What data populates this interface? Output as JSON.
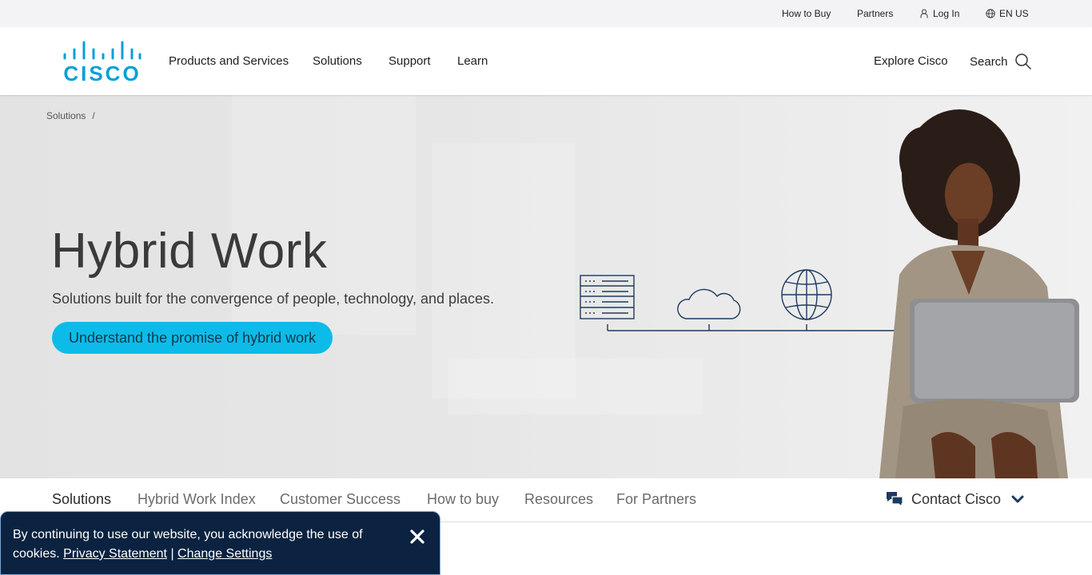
{
  "utility_bar": {
    "how_to_buy": "How to Buy",
    "partners": "Partners",
    "log_in": "Log In",
    "language": "EN US"
  },
  "header": {
    "logo_text": "CISCO",
    "nav": [
      "Products and Services",
      "Solutions",
      "Support",
      "Learn"
    ],
    "explore": "Explore Cisco",
    "search": "Search"
  },
  "hero": {
    "breadcrumb": {
      "item": "Solutions",
      "separator": "/"
    },
    "title": "Hybrid Work",
    "subtitle": "Solutions built for the convergence of people, technology, and places.",
    "cta": "Understand the promise of hybrid work"
  },
  "sub_nav": {
    "items": [
      "Solutions",
      "Hybrid Work Index",
      "Customer Success",
      "How to buy",
      "Resources",
      "For Partners"
    ],
    "active": "Solutions",
    "contact": "Contact Cisco"
  },
  "cookie_banner": {
    "text": "By continuing to use our website, you acknowledge the use of cookies.",
    "privacy_link": "Privacy Statement",
    "divider": "|",
    "settings_link": "Change Settings"
  },
  "colors": {
    "brand_blue": "#049fd9",
    "cta_background": "#0dbbe8",
    "cookie_background": "#0b2340",
    "illustration_stroke": "#1d3a5f"
  },
  "icons": {
    "user": "user-icon",
    "globe": "globe-icon",
    "search": "search-icon",
    "chat": "chat-icon",
    "chevron": "chevron-down-icon",
    "close": "close-icon",
    "server": "server-icon",
    "cloud": "cloud-icon",
    "network_globe": "network-globe-icon"
  }
}
